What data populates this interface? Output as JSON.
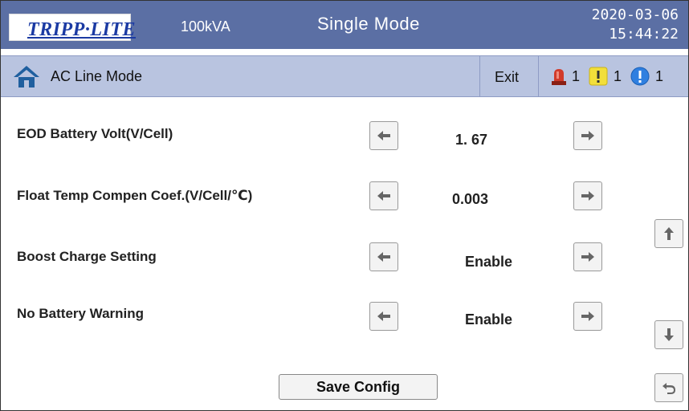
{
  "header": {
    "logo_text": "TRIPP·LITE",
    "capacity": "100kVA",
    "mode": "Single Mode",
    "date": "2020-03-06",
    "time": "15:44:22"
  },
  "subbar": {
    "title": "AC Line Mode",
    "exit_label": "Exit",
    "alarms": [
      {
        "icon": "red-beacon-icon",
        "count": "1",
        "color": "#d13a2a"
      },
      {
        "icon": "yellow-warning-icon",
        "count": "1",
        "color": "#f2df3a"
      },
      {
        "icon": "blue-info-icon",
        "count": "1",
        "color": "#2f7fe0"
      }
    ]
  },
  "settings": [
    {
      "label": "EOD Battery Volt(V/Cell)",
      "value": "1. 67"
    },
    {
      "label": "Float Temp Compen Coef.(V/Cell/℃)",
      "value": "0.003"
    },
    {
      "label": "Boost Charge Setting",
      "value": "Enable"
    },
    {
      "label": "No Battery Warning",
      "value": "Enable"
    }
  ],
  "footer": {
    "save_label": "Save Config"
  }
}
